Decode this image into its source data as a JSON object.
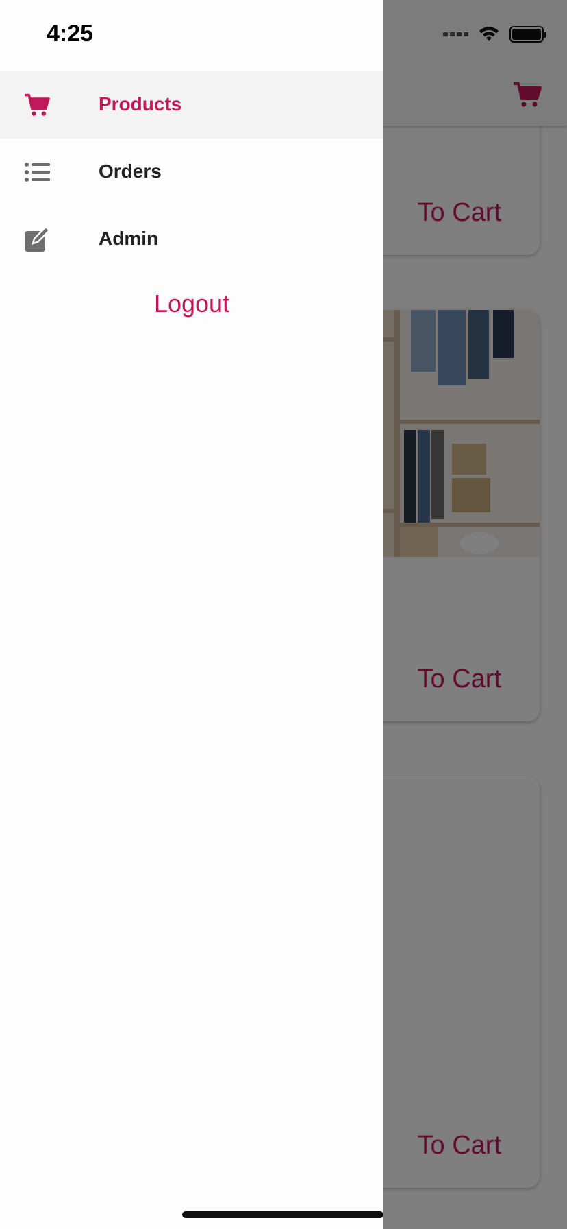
{
  "status_bar": {
    "time": "4:25"
  },
  "drawer": {
    "menu": [
      {
        "label": "Products",
        "icon": "cart-icon",
        "active": true
      },
      {
        "label": "Orders",
        "icon": "list-icon",
        "active": false
      },
      {
        "label": "Admin",
        "icon": "edit-icon",
        "active": false
      }
    ],
    "logout_label": "Logout"
  },
  "background": {
    "cards": [
      {
        "button_label": "To Cart"
      },
      {
        "button_label": "To Cart"
      },
      {
        "button_label": "To Cart"
      }
    ]
  },
  "colors": {
    "accent": "#c2185b",
    "menu_text": "#222222",
    "active_bg": "#f3f3f3",
    "icon_gray": "#6e6e6e"
  }
}
